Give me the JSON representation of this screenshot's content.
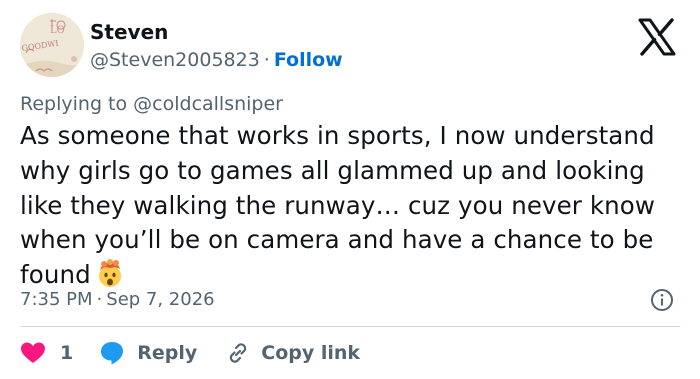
{
  "author": {
    "display_name": "Steven",
    "handle": "@Steven2005823",
    "separator": "·",
    "follow_label": "Follow"
  },
  "reply": {
    "prefix": "Replying to ",
    "target": "@coldcallsniper"
  },
  "tweet": {
    "text": "As someone that works in sports, I now understand why girls go to games all glammed up and looking like they walking the runway… cuz you never know when you’ll be on camera and have a chance to be found",
    "emoji": "exploding-head-emoji"
  },
  "meta": {
    "time": "7:35 PM",
    "separator": "·",
    "date": "Sep 7, 2026"
  },
  "actions": {
    "like_count": "1",
    "reply_label": "Reply",
    "copy_link_label": "Copy link"
  },
  "colors": {
    "text": "#0f1419",
    "secondary": "#536471",
    "link": "#006fd6",
    "like": "#f91880",
    "reply_icon": "#1d9bf0",
    "divider": "#cfd9de"
  },
  "icons": {
    "logo": "x-logo-icon",
    "info": "info-icon",
    "like": "heart-icon",
    "reply": "speech-bubble-icon",
    "copy": "link-icon"
  }
}
